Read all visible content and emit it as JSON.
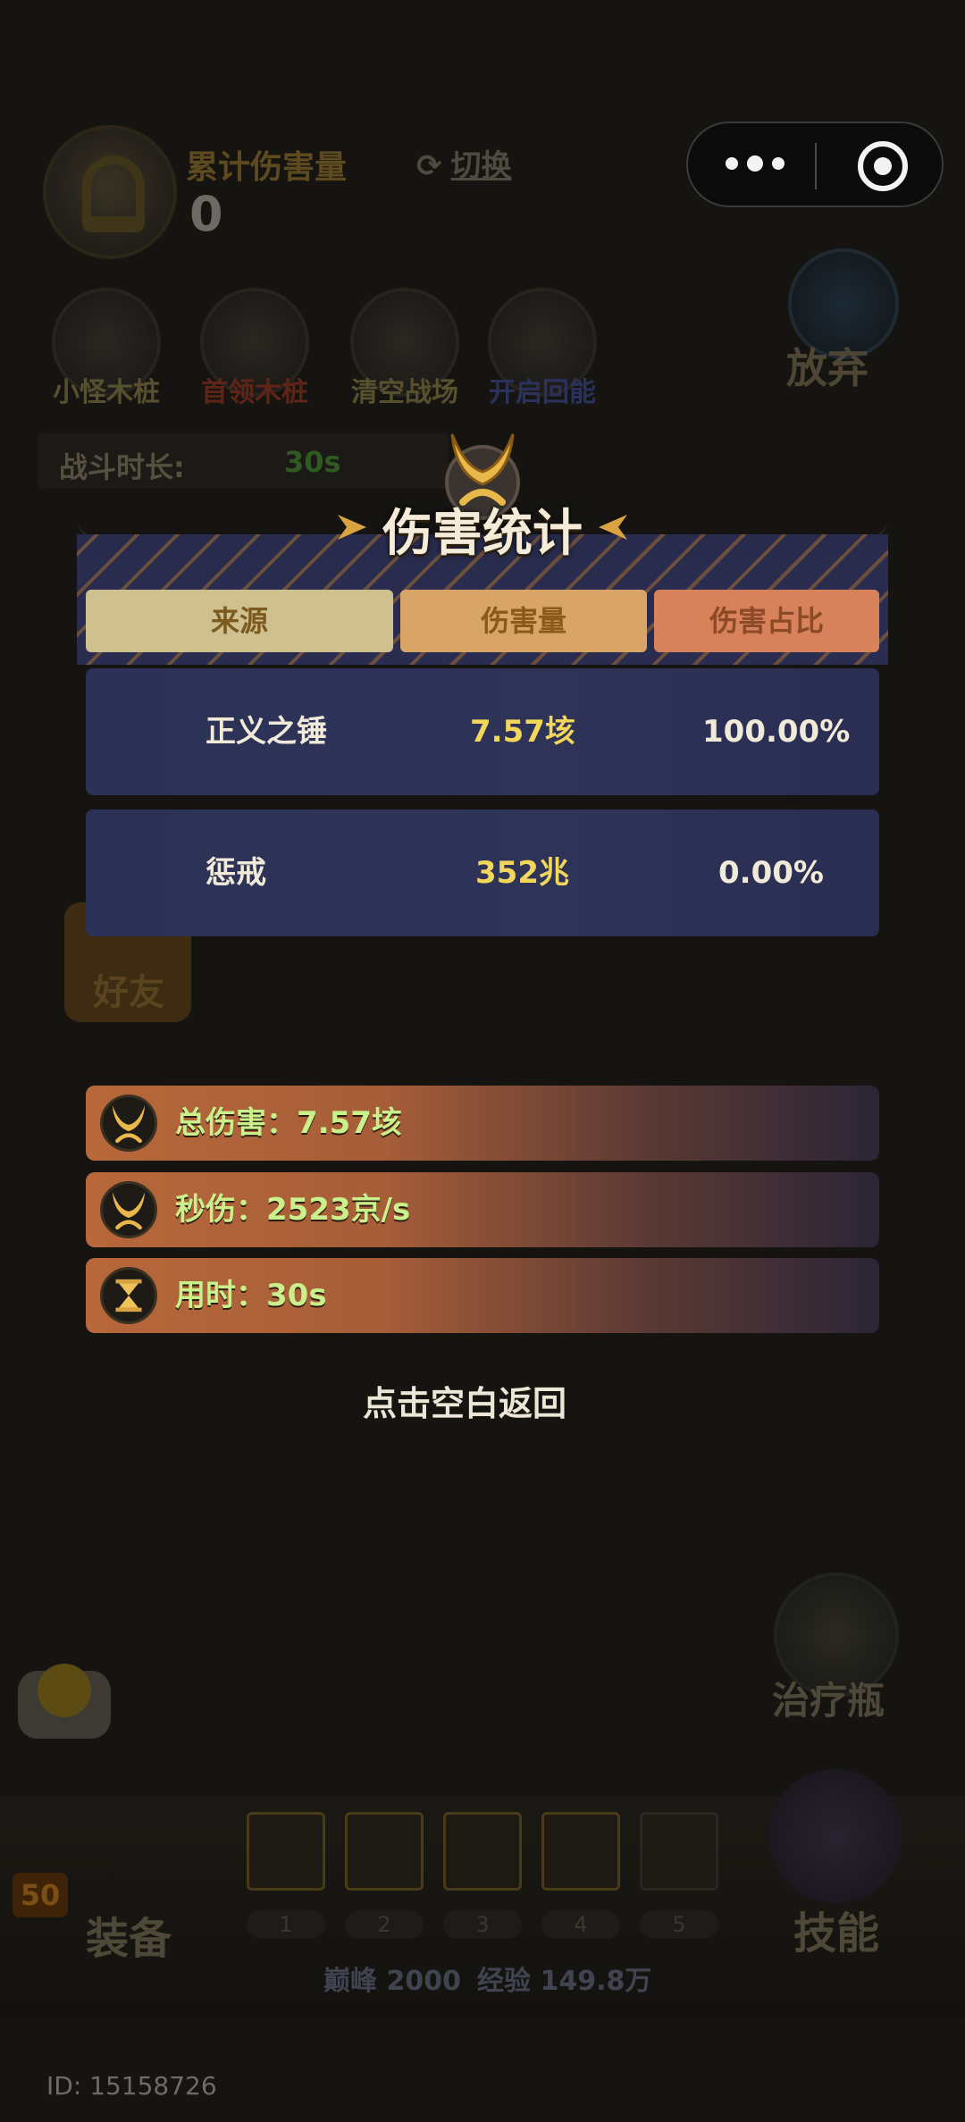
{
  "hud": {
    "damage_title": "累计伤害量",
    "damage_value": "0",
    "switch_label": "切换",
    "buttons": [
      {
        "label": "小怪木桩",
        "color": "#5a4f30"
      },
      {
        "label": "首领木桩",
        "color": "#5a2418"
      },
      {
        "label": "清空战场",
        "color": "#5a4f30"
      },
      {
        "label": "开启回能",
        "color": "#28305a"
      }
    ],
    "give_up_label": "放弃",
    "duration_label": "战斗时长:",
    "duration_value": "30s",
    "friend_label": "好友",
    "heal_label": "治疗瓶"
  },
  "capsule": {
    "more_icon": "more-dots-icon",
    "close_icon": "target-close-icon"
  },
  "modal": {
    "title": "伤害统计",
    "columns": [
      "来源",
      "伤害量",
      "伤害占比"
    ],
    "rows": [
      {
        "source": "正义之锤",
        "amount": "7.57垓",
        "ratio": "100.00%"
      },
      {
        "source": "惩戒",
        "amount": "352兆",
        "ratio": "0.00%"
      }
    ],
    "stats": [
      {
        "icon": "crest-icon",
        "text": "总伤害：7.57垓"
      },
      {
        "icon": "crest-icon",
        "text": "秒伤：2523京/s"
      },
      {
        "icon": "hourglass-icon",
        "text": "用时：30s"
      }
    ],
    "return_hint": "点击空白返回"
  },
  "bottom": {
    "level": "50",
    "equip_label": "装备",
    "skill_label": "技能",
    "slots": [
      "1",
      "2",
      "3",
      "4",
      "5"
    ],
    "peak": "巅峰 2000",
    "exp": "经验 149.8万",
    "uid": "ID: 15158726"
  },
  "colors": {
    "amount_yellow": "#f2d75a",
    "stat_green": "#c9f08a",
    "table_row_bg": "#2c3157",
    "header_source": "#cfc08f",
    "header_amount": "#d9a468",
    "header_ratio": "#d7825a"
  }
}
